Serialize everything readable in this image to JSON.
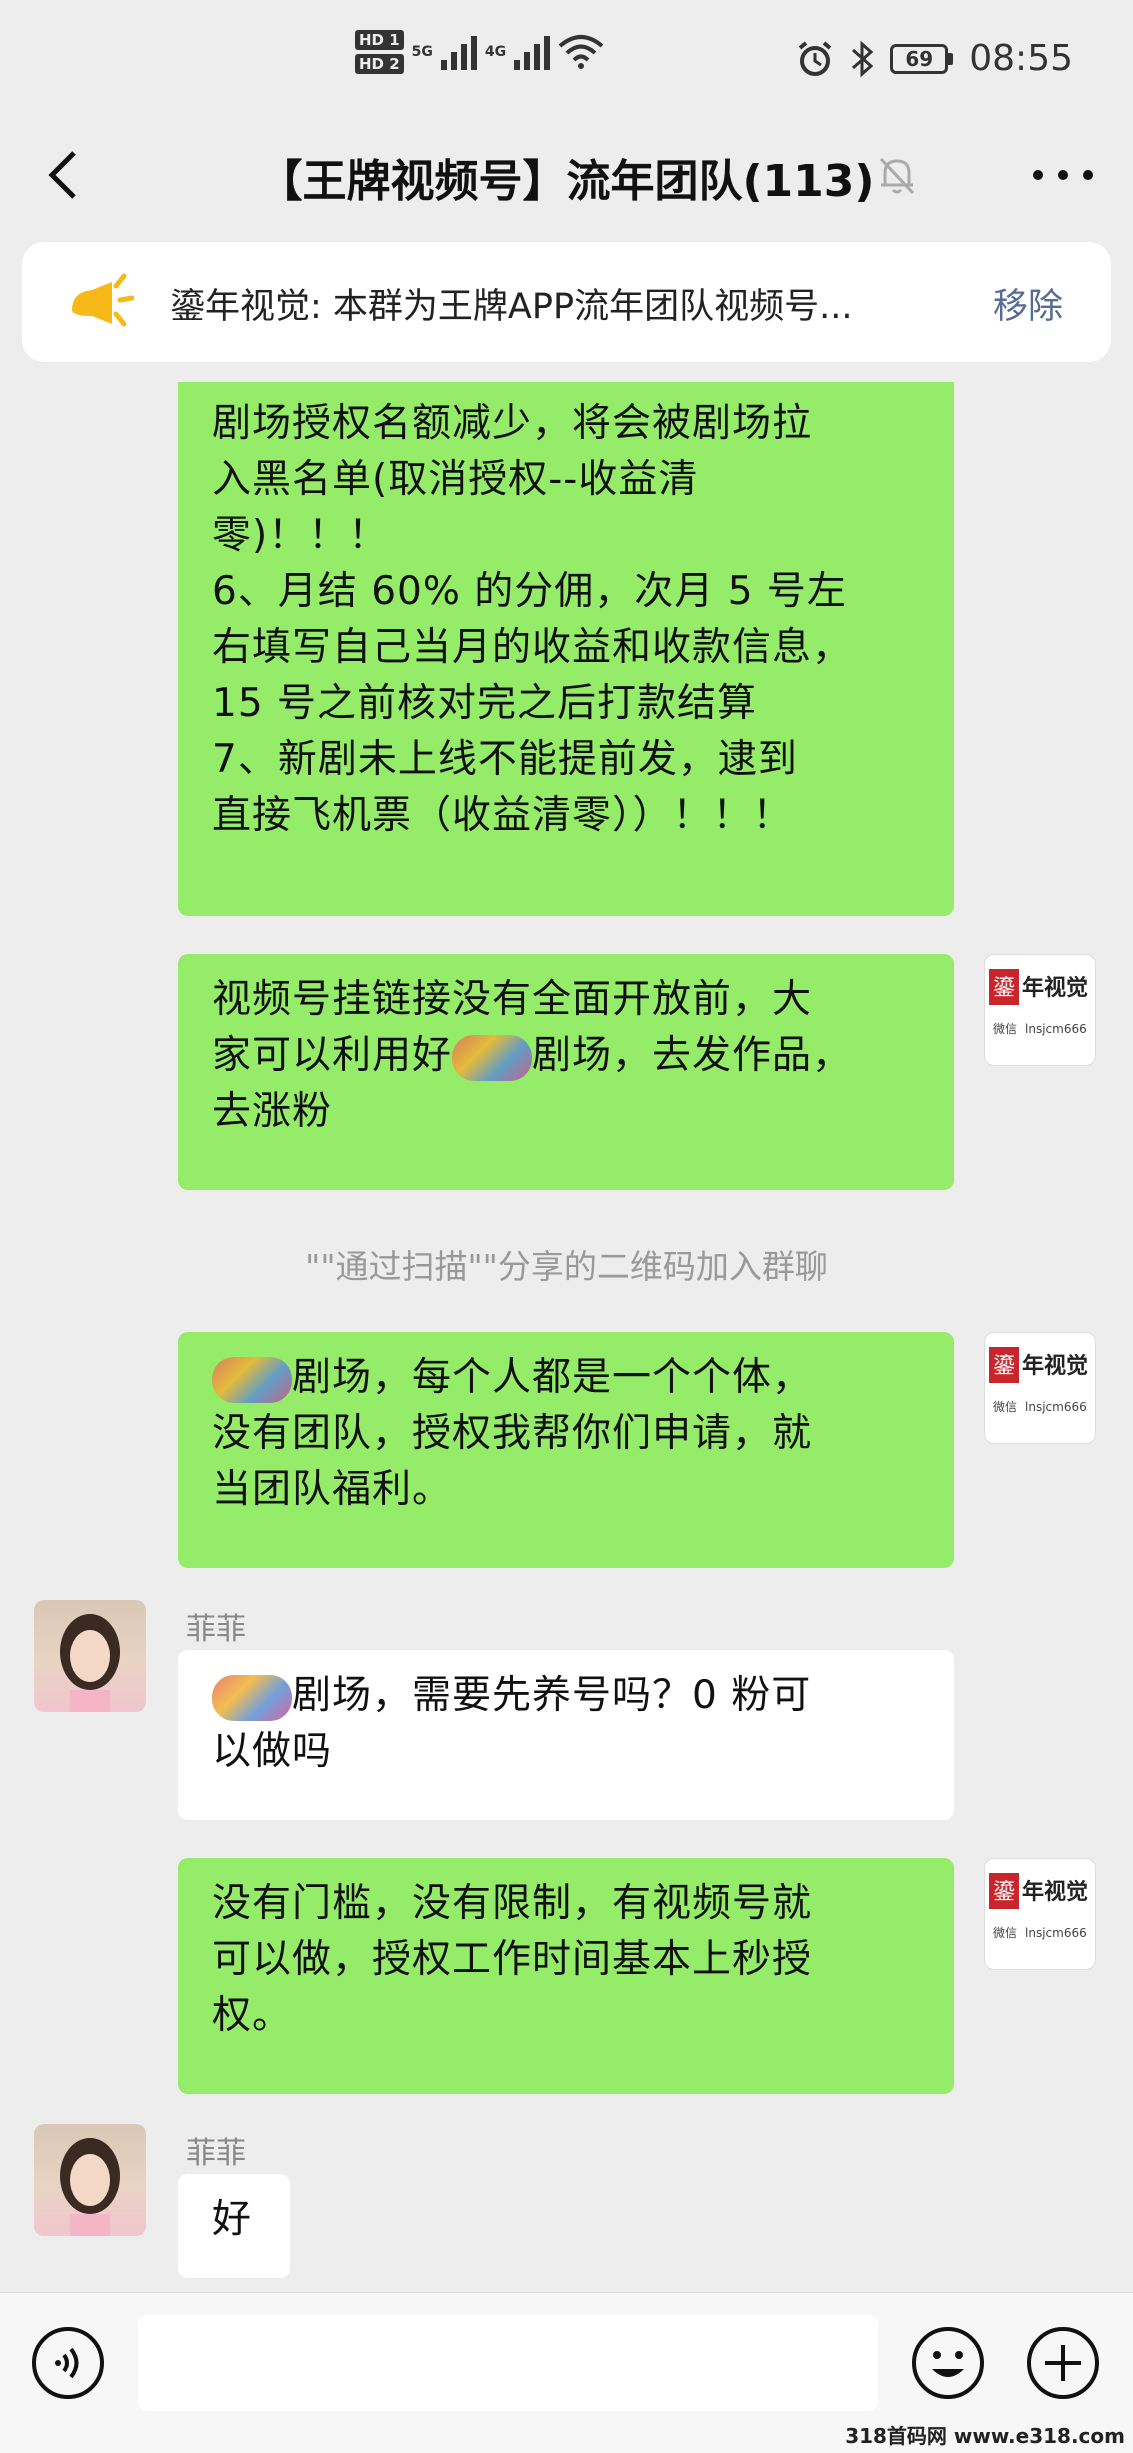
{
  "status_bar": {
    "hd1": "HD 1",
    "hd2": "HD 2",
    "net_5g": "5G",
    "net_4g": "4G",
    "battery": "69",
    "time": "08:55"
  },
  "header": {
    "title": "【王牌视频号】流年团队(113)"
  },
  "notice": {
    "text": "鎏年视觉: 本群为王牌APP流年团队视频号...",
    "remove_label": "移除"
  },
  "messages": [
    {
      "sender": "me",
      "lines": [
        "剧场授权名额减少，将会被剧场拉",
        "入黑名单(取消授权--收益清",
        "零)！！！",
        "6、月结 60% 的分佣，次月 5 号左",
        "右填写自己当月的收益和收款信息，",
        "15 号之前核对完之后打款结算",
        "7、新剧未上线不能提前发，逮到",
        "直接飞机票（收益清零））！！！"
      ]
    },
    {
      "sender": "me",
      "lines": [
        "视频号挂链接没有全面开放前，大",
        "家可以利用好",
        "剧场，去发作品，",
        "去涨粉"
      ]
    },
    {
      "type": "system",
      "text": "\"\"通过扫描\"\"分享的二维码加入群聊"
    },
    {
      "sender": "me",
      "lines": [
        "剧场，每个人都是一个个体，",
        "没有团队，授权我帮你们申请，就",
        "当团队福利。"
      ]
    },
    {
      "sender": "other",
      "nickname": "菲菲",
      "lines": [
        "剧场，需要先养号吗？0 粉可",
        "以做吗"
      ]
    },
    {
      "sender": "me",
      "lines": [
        "没有门槛，没有限制，有视频号就",
        "可以做，授权工作时间基本上秒授",
        "权。"
      ]
    },
    {
      "sender": "other",
      "nickname": "菲菲",
      "lines": [
        "好"
      ]
    }
  ],
  "my_avatar": {
    "logo_text": "鎏年视觉",
    "wechat_label": "微信",
    "wechat_id": "lnsjcm666"
  },
  "watermark": "318首码网 www.e318.com",
  "colors": {
    "my_bubble": "#95ec69",
    "other_bubble": "#ffffff",
    "background": "#ededed",
    "link": "#576b95"
  }
}
